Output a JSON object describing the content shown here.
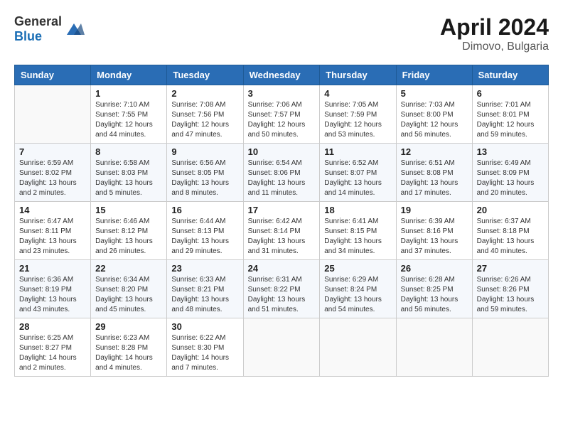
{
  "header": {
    "logo_general": "General",
    "logo_blue": "Blue",
    "month_year": "April 2024",
    "location": "Dimovo, Bulgaria"
  },
  "weekdays": [
    "Sunday",
    "Monday",
    "Tuesday",
    "Wednesday",
    "Thursday",
    "Friday",
    "Saturday"
  ],
  "weeks": [
    [
      {
        "day": "",
        "info": ""
      },
      {
        "day": "1",
        "info": "Sunrise: 7:10 AM\nSunset: 7:55 PM\nDaylight: 12 hours\nand 44 minutes."
      },
      {
        "day": "2",
        "info": "Sunrise: 7:08 AM\nSunset: 7:56 PM\nDaylight: 12 hours\nand 47 minutes."
      },
      {
        "day": "3",
        "info": "Sunrise: 7:06 AM\nSunset: 7:57 PM\nDaylight: 12 hours\nand 50 minutes."
      },
      {
        "day": "4",
        "info": "Sunrise: 7:05 AM\nSunset: 7:59 PM\nDaylight: 12 hours\nand 53 minutes."
      },
      {
        "day": "5",
        "info": "Sunrise: 7:03 AM\nSunset: 8:00 PM\nDaylight: 12 hours\nand 56 minutes."
      },
      {
        "day": "6",
        "info": "Sunrise: 7:01 AM\nSunset: 8:01 PM\nDaylight: 12 hours\nand 59 minutes."
      }
    ],
    [
      {
        "day": "7",
        "info": "Sunrise: 6:59 AM\nSunset: 8:02 PM\nDaylight: 13 hours\nand 2 minutes."
      },
      {
        "day": "8",
        "info": "Sunrise: 6:58 AM\nSunset: 8:03 PM\nDaylight: 13 hours\nand 5 minutes."
      },
      {
        "day": "9",
        "info": "Sunrise: 6:56 AM\nSunset: 8:05 PM\nDaylight: 13 hours\nand 8 minutes."
      },
      {
        "day": "10",
        "info": "Sunrise: 6:54 AM\nSunset: 8:06 PM\nDaylight: 13 hours\nand 11 minutes."
      },
      {
        "day": "11",
        "info": "Sunrise: 6:52 AM\nSunset: 8:07 PM\nDaylight: 13 hours\nand 14 minutes."
      },
      {
        "day": "12",
        "info": "Sunrise: 6:51 AM\nSunset: 8:08 PM\nDaylight: 13 hours\nand 17 minutes."
      },
      {
        "day": "13",
        "info": "Sunrise: 6:49 AM\nSunset: 8:09 PM\nDaylight: 13 hours\nand 20 minutes."
      }
    ],
    [
      {
        "day": "14",
        "info": "Sunrise: 6:47 AM\nSunset: 8:11 PM\nDaylight: 13 hours\nand 23 minutes."
      },
      {
        "day": "15",
        "info": "Sunrise: 6:46 AM\nSunset: 8:12 PM\nDaylight: 13 hours\nand 26 minutes."
      },
      {
        "day": "16",
        "info": "Sunrise: 6:44 AM\nSunset: 8:13 PM\nDaylight: 13 hours\nand 29 minutes."
      },
      {
        "day": "17",
        "info": "Sunrise: 6:42 AM\nSunset: 8:14 PM\nDaylight: 13 hours\nand 31 minutes."
      },
      {
        "day": "18",
        "info": "Sunrise: 6:41 AM\nSunset: 8:15 PM\nDaylight: 13 hours\nand 34 minutes."
      },
      {
        "day": "19",
        "info": "Sunrise: 6:39 AM\nSunset: 8:16 PM\nDaylight: 13 hours\nand 37 minutes."
      },
      {
        "day": "20",
        "info": "Sunrise: 6:37 AM\nSunset: 8:18 PM\nDaylight: 13 hours\nand 40 minutes."
      }
    ],
    [
      {
        "day": "21",
        "info": "Sunrise: 6:36 AM\nSunset: 8:19 PM\nDaylight: 13 hours\nand 43 minutes."
      },
      {
        "day": "22",
        "info": "Sunrise: 6:34 AM\nSunset: 8:20 PM\nDaylight: 13 hours\nand 45 minutes."
      },
      {
        "day": "23",
        "info": "Sunrise: 6:33 AM\nSunset: 8:21 PM\nDaylight: 13 hours\nand 48 minutes."
      },
      {
        "day": "24",
        "info": "Sunrise: 6:31 AM\nSunset: 8:22 PM\nDaylight: 13 hours\nand 51 minutes."
      },
      {
        "day": "25",
        "info": "Sunrise: 6:29 AM\nSunset: 8:24 PM\nDaylight: 13 hours\nand 54 minutes."
      },
      {
        "day": "26",
        "info": "Sunrise: 6:28 AM\nSunset: 8:25 PM\nDaylight: 13 hours\nand 56 minutes."
      },
      {
        "day": "27",
        "info": "Sunrise: 6:26 AM\nSunset: 8:26 PM\nDaylight: 13 hours\nand 59 minutes."
      }
    ],
    [
      {
        "day": "28",
        "info": "Sunrise: 6:25 AM\nSunset: 8:27 PM\nDaylight: 14 hours\nand 2 minutes."
      },
      {
        "day": "29",
        "info": "Sunrise: 6:23 AM\nSunset: 8:28 PM\nDaylight: 14 hours\nand 4 minutes."
      },
      {
        "day": "30",
        "info": "Sunrise: 6:22 AM\nSunset: 8:30 PM\nDaylight: 14 hours\nand 7 minutes."
      },
      {
        "day": "",
        "info": ""
      },
      {
        "day": "",
        "info": ""
      },
      {
        "day": "",
        "info": ""
      },
      {
        "day": "",
        "info": ""
      }
    ]
  ]
}
